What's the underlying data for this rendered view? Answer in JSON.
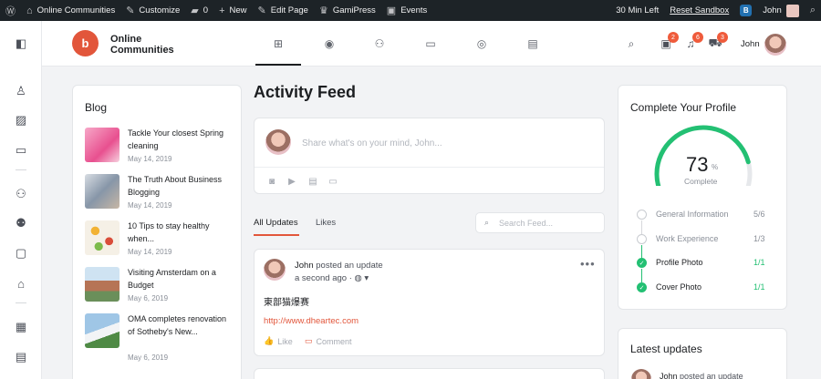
{
  "adminbar": {
    "site_name": "Online Communities",
    "customize": "Customize",
    "comments_count": "0",
    "new": "New",
    "edit_page": "Edit Page",
    "gamipress": "GamiPress",
    "events": "Events",
    "time_left": "30 Min Left",
    "reset_sandbox": "Reset Sandbox",
    "user_badge": "B",
    "user_name": "John"
  },
  "header": {
    "logo_letter": "b",
    "site_title": "Online Communities",
    "user_name": "John",
    "notifications": {
      "messages": "2",
      "bell": "6",
      "cart": "3"
    }
  },
  "blog": {
    "title": "Blog",
    "posts": [
      {
        "title": "Tackle Your closest Spring cleaning",
        "date": "May 14, 2019"
      },
      {
        "title": "The Truth About Business Blogging",
        "date": "May 14, 2019"
      },
      {
        "title": "10 Tips to stay healthy when...",
        "date": "May 14, 2019"
      },
      {
        "title": "Visiting Amsterdam on a Budget",
        "date": "May 6, 2019"
      },
      {
        "title": "OMA completes renovation of Sotheby's New...",
        "date": "May 6, 2019"
      }
    ]
  },
  "feed": {
    "title": "Activity Feed",
    "composer_placeholder": "Share what's on your mind, John...",
    "tabs": [
      "All Updates",
      "Likes"
    ],
    "search_placeholder": "Search Feed...",
    "activity": {
      "author": "John",
      "action": "posted an update",
      "time": "a second ago",
      "body": "東部猫爆赛",
      "link": "http://www.dheartec.com",
      "like": "Like",
      "comment": "Comment"
    }
  },
  "profile": {
    "title": "Complete Your Profile",
    "percent": "73",
    "percent_value": 0.73,
    "unit": "%",
    "complete_label": "Complete",
    "steps": [
      {
        "label": "General Information",
        "value": "5/6",
        "done": false
      },
      {
        "label": "Work Experience",
        "value": "1/3",
        "done": false
      },
      {
        "label": "Profile Photo",
        "value": "1/1",
        "done": true
      },
      {
        "label": "Cover Photo",
        "value": "1/1",
        "done": true
      }
    ]
  },
  "latest": {
    "title": "Latest updates",
    "author": "John",
    "action": "posted an update"
  },
  "colors": {
    "accent": "#e2563b",
    "success": "#23c073",
    "adminbar": "#1d2327"
  }
}
